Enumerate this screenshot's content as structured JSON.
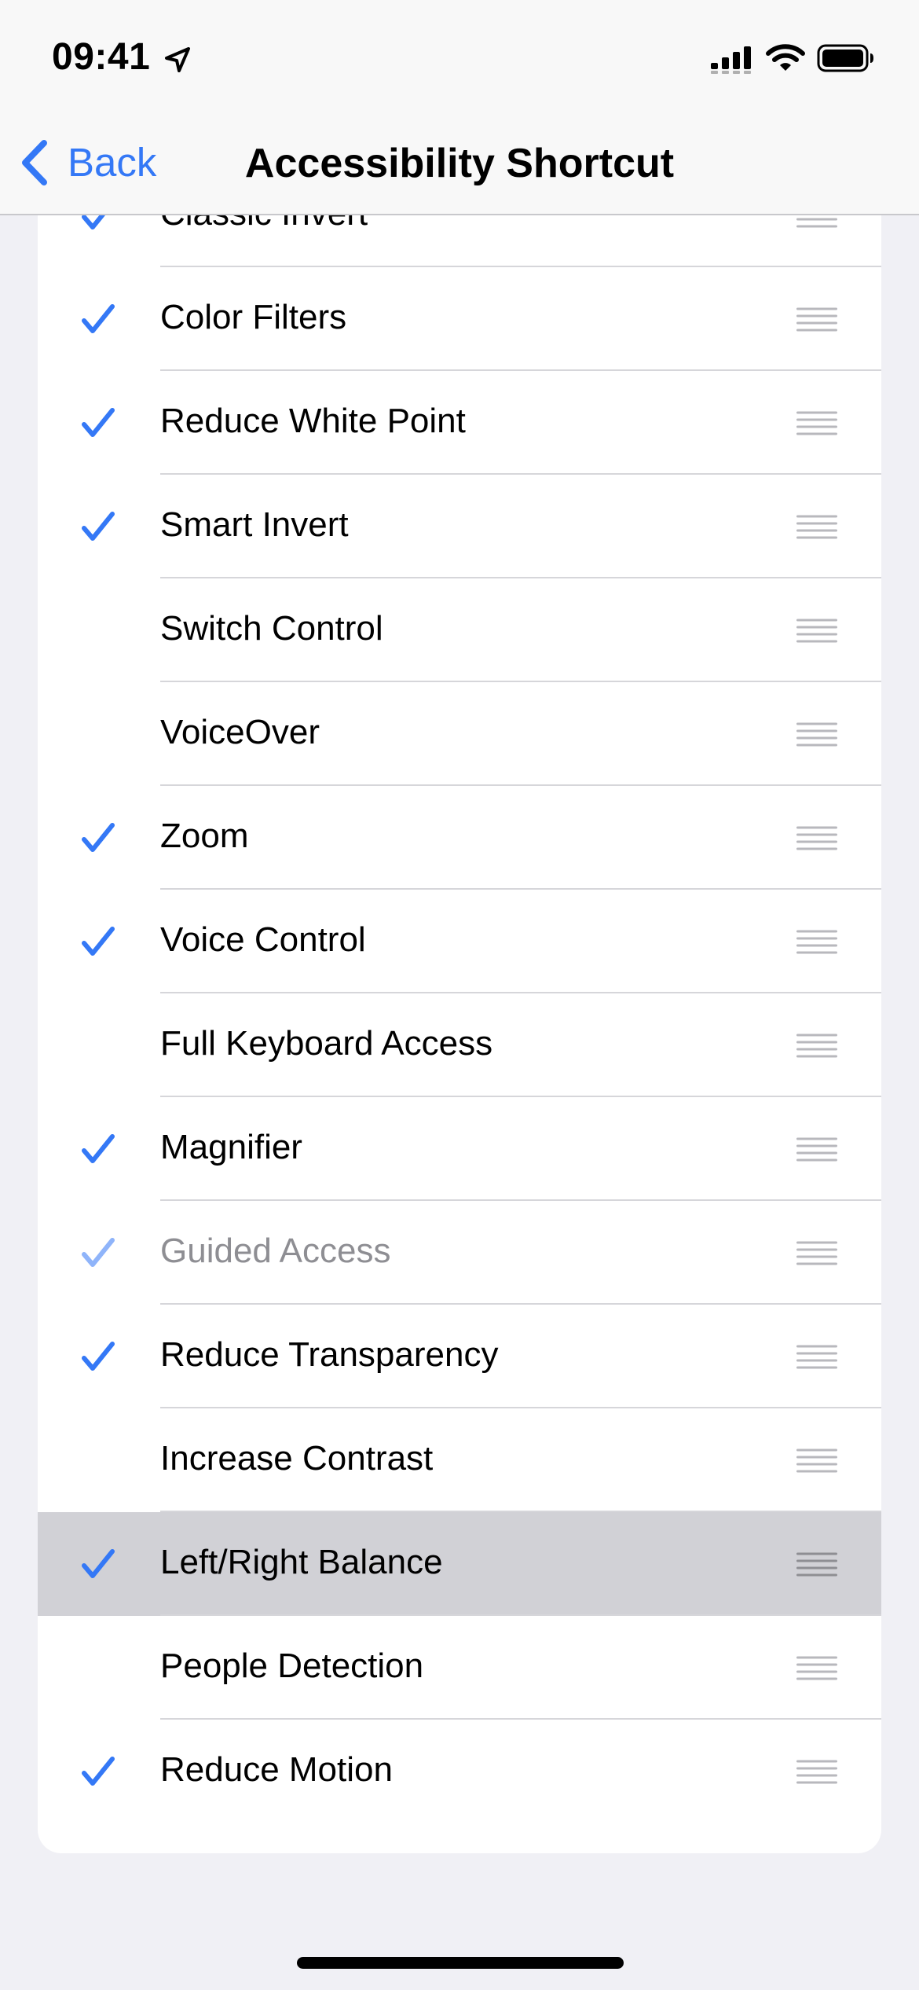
{
  "status_bar": {
    "time": "09:41",
    "icons": [
      "location-arrow-icon",
      "cellular-signal-icon",
      "wifi-icon",
      "battery-icon"
    ]
  },
  "nav": {
    "back_label": "Back",
    "title": "Accessibility Shortcut"
  },
  "colors": {
    "accent": "#3478f6",
    "highlight_row": "#d1d1d6",
    "background": "#f0f0f5"
  },
  "rows": [
    {
      "label": "Classic Invert",
      "checked": true
    },
    {
      "label": "Color Filters",
      "checked": true
    },
    {
      "label": "Reduce White Point",
      "checked": true
    },
    {
      "label": "Smart Invert",
      "checked": true
    },
    {
      "label": "Switch Control",
      "checked": false
    },
    {
      "label": "VoiceOver",
      "checked": false
    },
    {
      "label": "Zoom",
      "checked": true
    },
    {
      "label": "Voice Control",
      "checked": true
    },
    {
      "label": "Full Keyboard Access",
      "checked": false
    },
    {
      "label": "Magnifier",
      "checked": true
    },
    {
      "label": "Guided Access",
      "checked": true,
      "dimmed": true
    },
    {
      "label": "Reduce Transparency",
      "checked": true
    },
    {
      "label": "Increase Contrast",
      "checked": false
    },
    {
      "label": "Left/Right Balance",
      "checked": true,
      "highlighted": true
    },
    {
      "label": "People Detection",
      "checked": false
    },
    {
      "label": "Reduce Motion",
      "checked": true
    }
  ]
}
